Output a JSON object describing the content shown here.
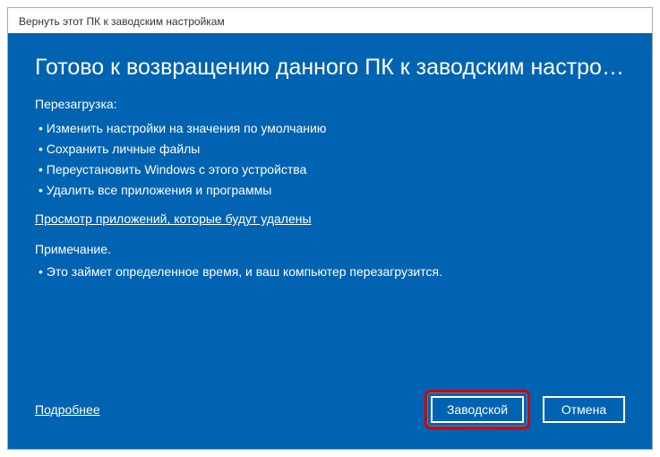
{
  "window": {
    "title": "Вернуть этот ПК к заводским настройкам"
  },
  "heading": "Готово к возвращению данного ПК к заводским настройк...",
  "reboot_label": "Перезагрузка:",
  "bullets": {
    "b0": "Изменить настройки на значения по умолчанию",
    "b1": "Сохранить личные файлы",
    "b2": "Переустановить Windows с этого устройства",
    "b3": "Удалить все приложения и программы"
  },
  "apps_link": "Просмотр приложений, которые будут удалены",
  "note_head": "Примечание.",
  "note_bullet": "Это займет определенное время, и ваш компьютер перезагрузится.",
  "more_link": "Подробнее",
  "buttons": {
    "reset": "Заводской",
    "cancel": "Отмена"
  }
}
